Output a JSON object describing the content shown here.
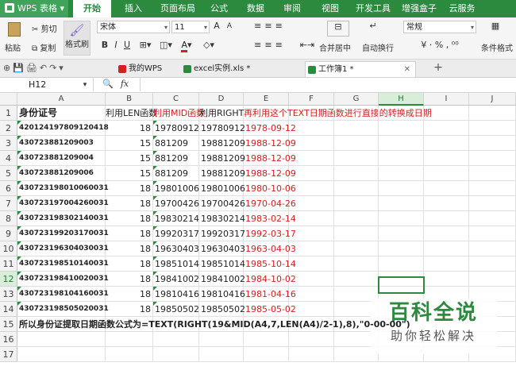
{
  "app": {
    "name": "WPS 表格"
  },
  "menu": [
    "开始",
    "插入",
    "页面布局",
    "公式",
    "数据",
    "审阅",
    "视图",
    "开发工具",
    "增强盒子",
    "云服务"
  ],
  "ribbon": {
    "paste": "粘贴",
    "cut": "剪切",
    "copy": "复制",
    "format_painter": "格式刷",
    "font": "宋体",
    "font_size": "11",
    "number_format": "常规",
    "merge": "合并居中",
    "wrap": "自动换行",
    "conditional": "条件格式"
  },
  "doc_tabs": [
    {
      "label": "我的WPS",
      "color": "#d42020"
    },
    {
      "label": "excel实例.xls *",
      "color": "#2b8a3e"
    },
    {
      "label": "工作簿1 *",
      "color": "#2b8a3e"
    }
  ],
  "formula_bar": {
    "name_box": "H12",
    "fx": "fx",
    "value": ""
  },
  "grid": {
    "columns": [
      "A",
      "B",
      "C",
      "D",
      "E",
      "F",
      "G",
      "H",
      "I",
      "J"
    ],
    "selected_cell": "H12",
    "row1": [
      "身份证号",
      "利用LEN函数",
      "利用MID函数",
      "利用RIGHT",
      "再利用这个TEXT日期函数进行直接的转换成日期"
    ],
    "rows": [
      {
        "n": "2",
        "a": "420124197809120418",
        "b": "18",
        "c": "19780912",
        "d": "19780912",
        "e": "1978-09-12"
      },
      {
        "n": "3",
        "a": "430723881209003",
        "b": "15",
        "c": "881209",
        "d": "19881209",
        "e": "1988-12-09"
      },
      {
        "n": "4",
        "a": "430723881209004",
        "b": "15",
        "c": "881209",
        "d": "19881209",
        "e": "1988-12-09"
      },
      {
        "n": "5",
        "a": "430723881209006",
        "b": "15",
        "c": "881209",
        "d": "19881209",
        "e": "1988-12-09"
      },
      {
        "n": "6",
        "a": "430723198010060031",
        "b": "18",
        "c": "19801006",
        "d": "19801006",
        "e": "1980-10-06"
      },
      {
        "n": "7",
        "a": "430723197004260031",
        "b": "18",
        "c": "19700426",
        "d": "19700426",
        "e": "1970-04-26"
      },
      {
        "n": "8",
        "a": "430723198302140031",
        "b": "18",
        "c": "19830214",
        "d": "19830214",
        "e": "1983-02-14"
      },
      {
        "n": "9",
        "a": "430723199203170031",
        "b": "18",
        "c": "19920317",
        "d": "19920317",
        "e": "1992-03-17"
      },
      {
        "n": "10",
        "a": "430723196304030031",
        "b": "18",
        "c": "19630403",
        "d": "19630403",
        "e": "1963-04-03"
      },
      {
        "n": "11",
        "a": "430723198510140031",
        "b": "18",
        "c": "19851014",
        "d": "19851014",
        "e": "1985-10-14"
      },
      {
        "n": "12",
        "a": "430723198410020031",
        "b": "18",
        "c": "19841002",
        "d": "19841002",
        "e": "1984-10-02"
      },
      {
        "n": "13",
        "a": "430723198104160031",
        "b": "18",
        "c": "19810416",
        "d": "19810416",
        "e": "1981-04-16"
      },
      {
        "n": "14",
        "a": "430723198505020031",
        "b": "18",
        "c": "19850502",
        "d": "19850502",
        "e": "1985-05-02"
      }
    ],
    "row15": "所以身份证提取日期函数公式为=TEXT(RIGHT(19&MID(A4,7,LEN(A4)/2-1),8),\"0-00-00\")"
  },
  "watermark": {
    "line1": "百科全说",
    "line2": "助你轻松解决"
  }
}
